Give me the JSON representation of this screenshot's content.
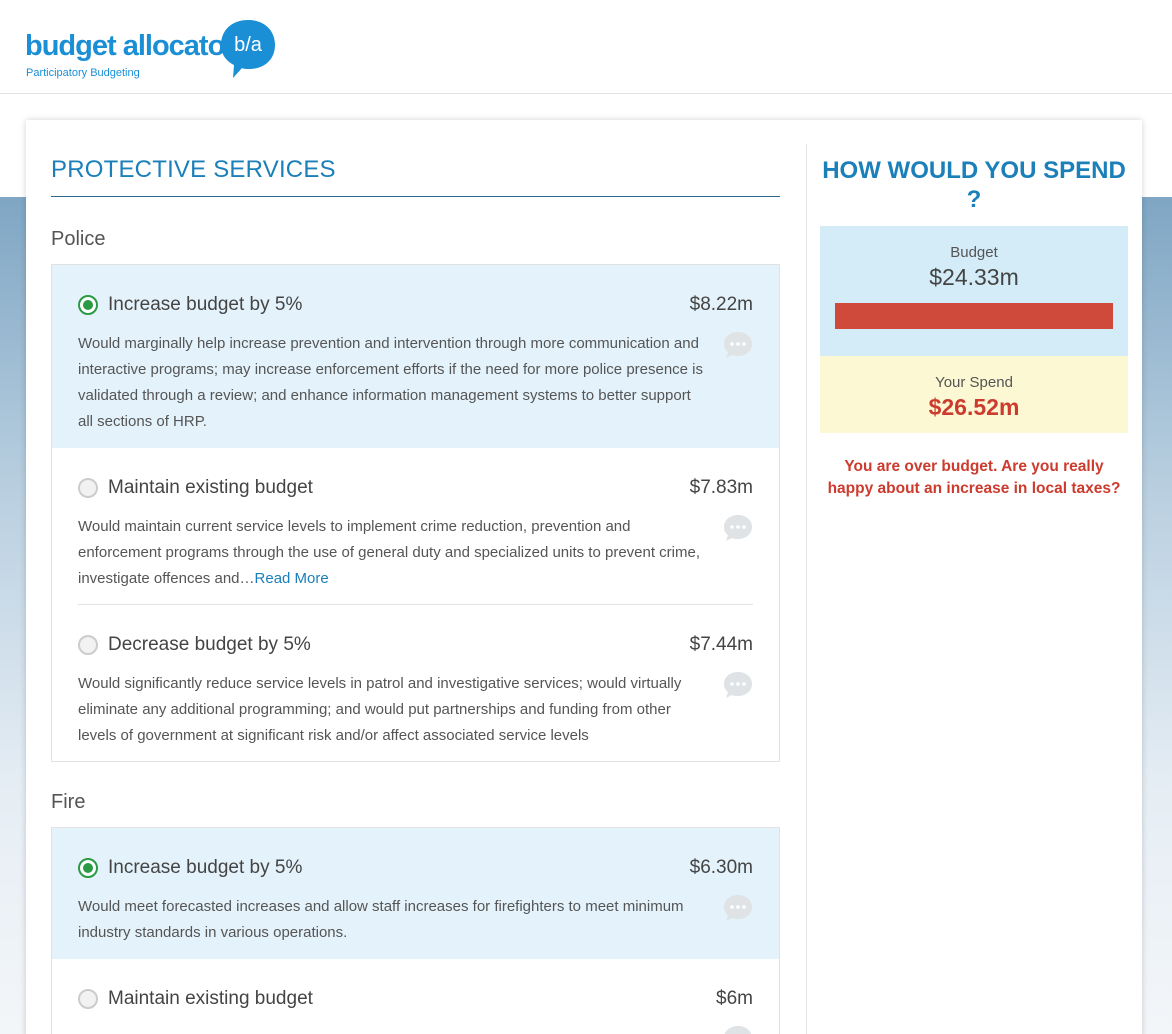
{
  "header": {
    "logo_text": "budget allocator",
    "logo_tagline": "Participatory Budgeting",
    "logo_mark": "b/a"
  },
  "main": {
    "section_title": "PROTECTIVE SERVICES",
    "groups": [
      {
        "label": "Police",
        "options": [
          {
            "title": "Increase budget by 5%",
            "price": "$8.22m",
            "selected": true,
            "description": "Would marginally help increase prevention and intervention through more communication and interactive programs; may increase enforcement efforts if the need for more police presence is validated through a review; and enhance information management systems to better support all sections of HRP."
          },
          {
            "title": "Maintain existing budget",
            "price": "$7.83m",
            "selected": false,
            "description": "Would maintain current service levels to implement crime reduction, prevention and enforcement programs through the use of general duty and specialized units to prevent crime, investigate offences and…",
            "read_more": "Read More"
          },
          {
            "title": "Decrease budget by 5%",
            "price": "$7.44m",
            "selected": false,
            "description": "Would significantly reduce service levels in patrol and investigative services; would virtually eliminate any additional programming; and would put partnerships and funding from other levels of government at significant risk and/or affect associated service levels"
          }
        ]
      },
      {
        "label": "Fire",
        "options": [
          {
            "title": "Increase budget by 5%",
            "price": "$6.30m",
            "selected": true,
            "description": "Would meet forecasted increases and allow staff increases for firefighters to meet minimum industry standards in various operations."
          },
          {
            "title": "Maintain existing budget",
            "price": "$6m",
            "selected": false,
            "description": ""
          }
        ]
      }
    ]
  },
  "sidebar": {
    "title": "HOW WOULD YOU SPEND ?",
    "budget_label": "Budget",
    "budget_value": "$24.33m",
    "spend_label": "Your Spend",
    "spend_value": "$26.52m",
    "warning": "You are over budget. Are you really happy about an increase in local taxes?"
  },
  "colors": {
    "brand": "#1b7fba",
    "selected_bg": "#e4f3fb",
    "over_budget": "#cc3b2e",
    "radio_on": "#2a9a45"
  },
  "icons": [
    "speech-bubble-logo-icon",
    "radio-icon",
    "comment-icon"
  ]
}
